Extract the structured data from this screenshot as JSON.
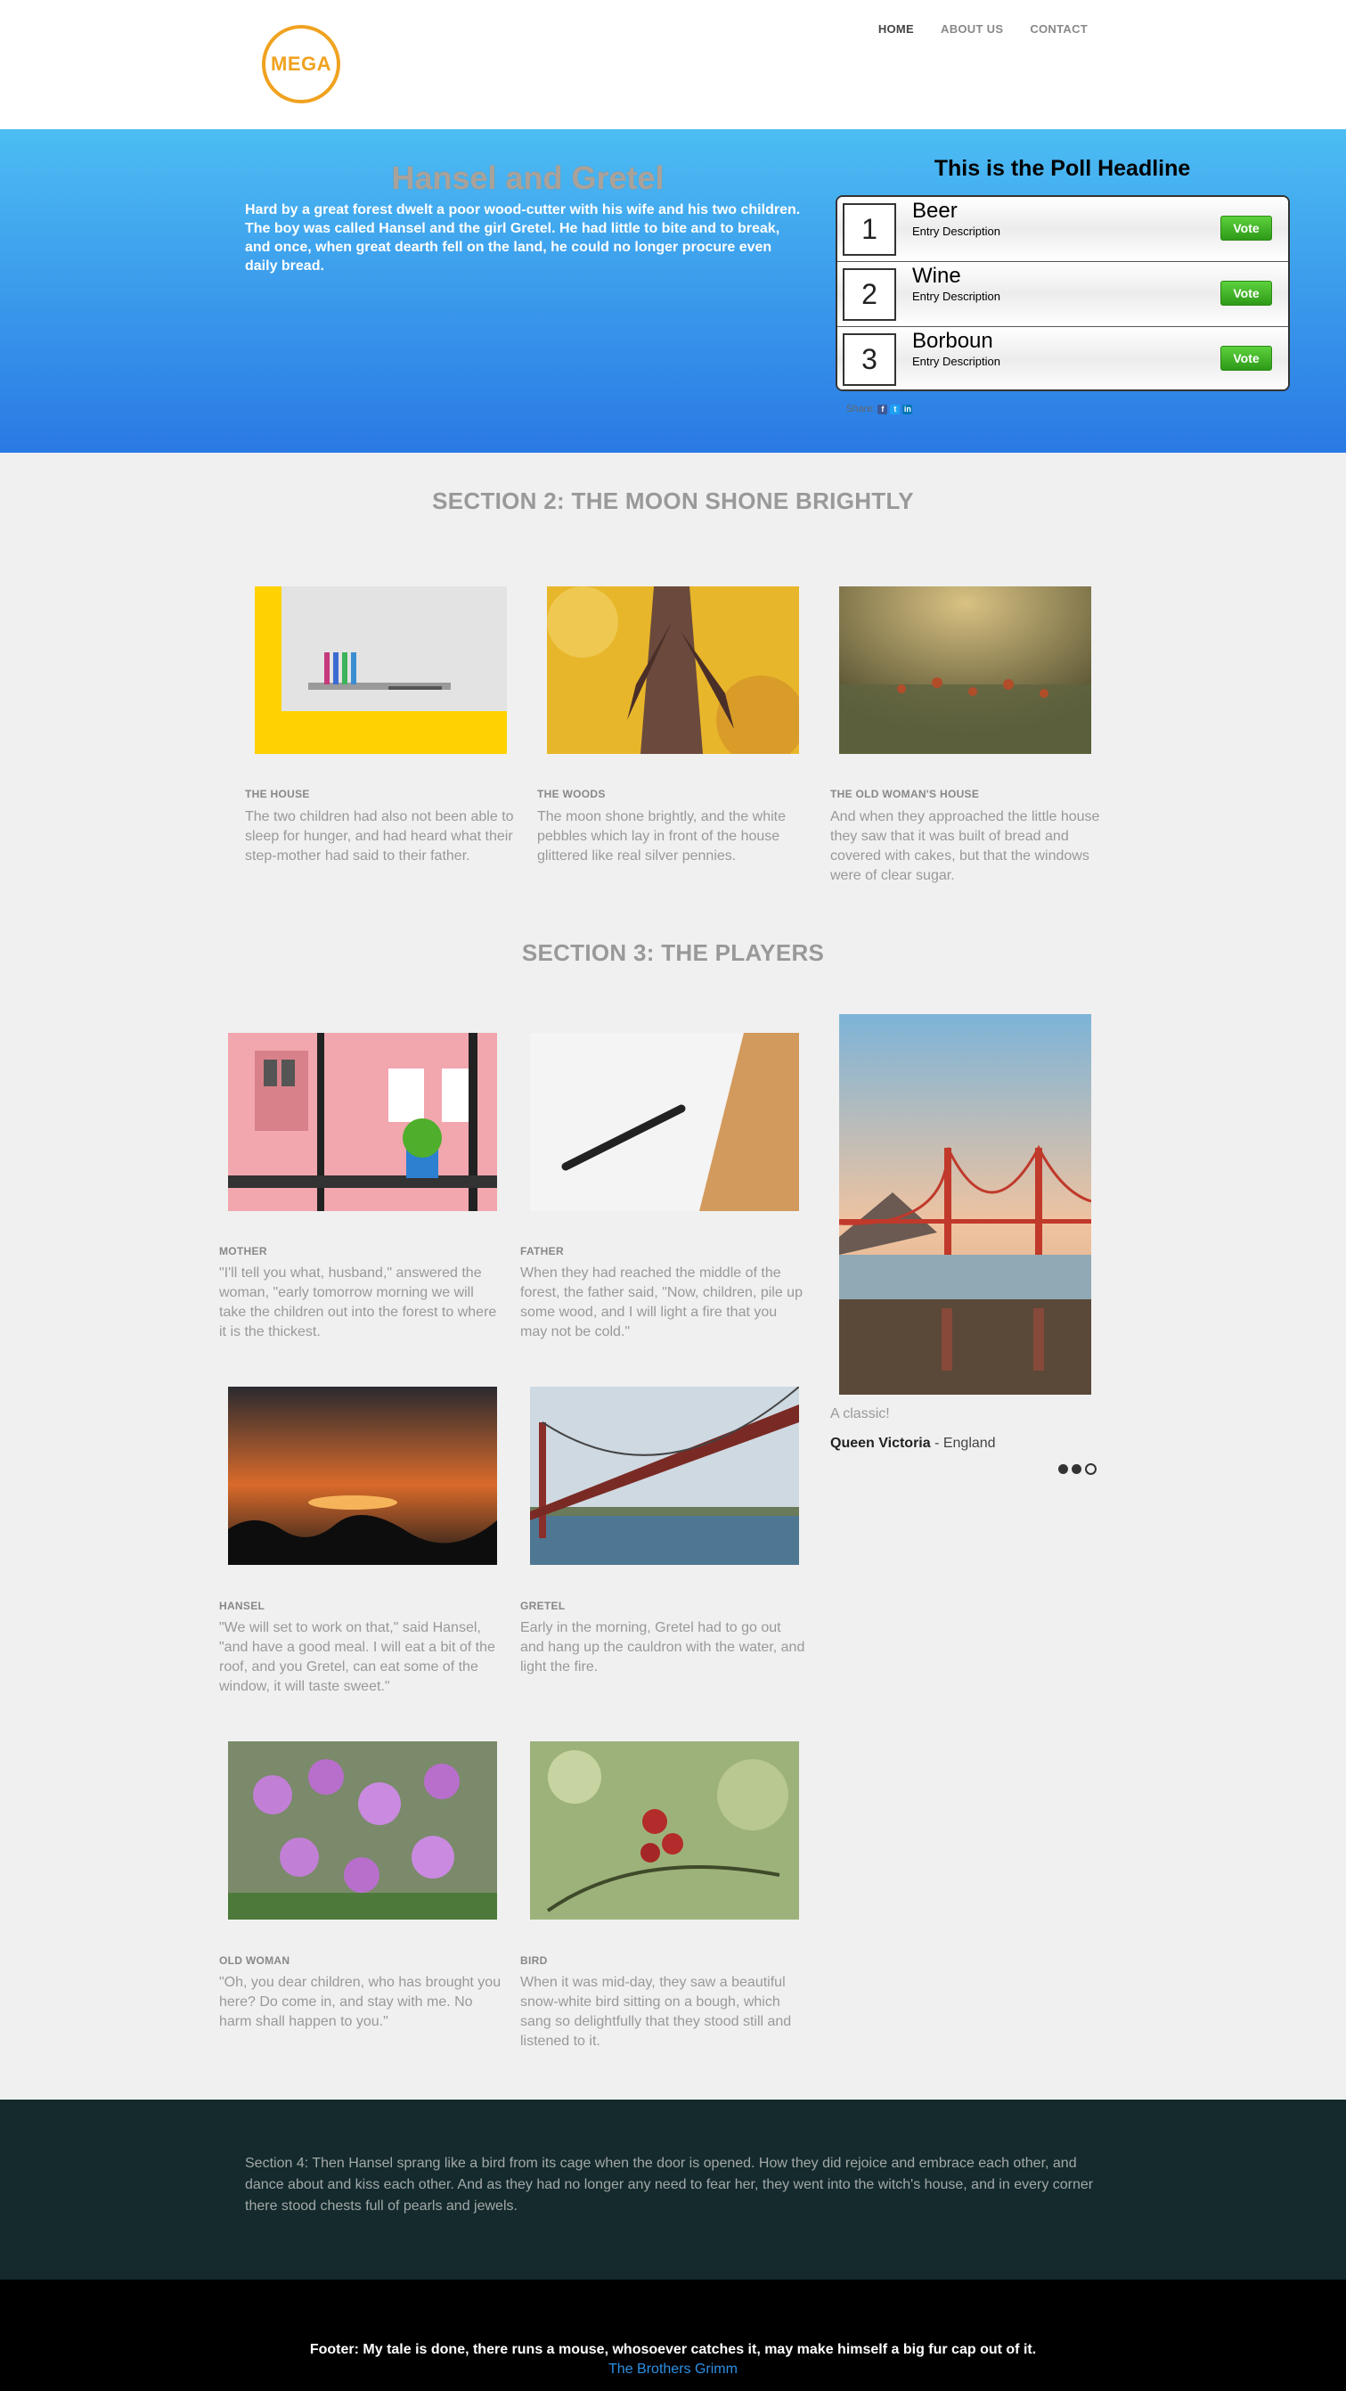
{
  "header": {
    "logo_text": "MEGA",
    "nav": [
      {
        "label": "HOME",
        "active": true
      },
      {
        "label": "ABOUT US",
        "active": false
      },
      {
        "label": "CONTACT",
        "active": false
      }
    ]
  },
  "hero": {
    "title": "Hansel and Gretel",
    "text": "Hard by a great forest dwelt a poor wood-cutter with his wife and his two children. The boy was called Hansel and the girl Gretel. He had little to bite and to break, and once, when great dearth fell on the land, he could no longer procure even daily bread."
  },
  "poll": {
    "headline": "This is the Poll Headline",
    "items": [
      {
        "number": "1",
        "name": "Beer",
        "description": "Entry Description",
        "vote_label": "Vote"
      },
      {
        "number": "2",
        "name": "Wine",
        "description": "Entry Description",
        "vote_label": "Vote"
      },
      {
        "number": "3",
        "name": "Borboun",
        "description": "Entry Description",
        "vote_label": "Vote"
      }
    ],
    "share_label": "Share:",
    "share_icons": [
      "facebook-icon",
      "twitter-icon",
      "linkedin-icon"
    ]
  },
  "section2": {
    "title": "SECTION 2: THE MOON SHONE BRIGHTLY",
    "cards": [
      {
        "label": "THE HOUSE",
        "text": "The two children had also not been able to sleep for hunger, and had heard what their step-mother had said to their father."
      },
      {
        "label": "THE WOODS",
        "text": "The moon shone brightly, and the white pebbles which lay in front of the house glittered like real silver pennies."
      },
      {
        "label": "THE OLD WOMAN'S HOUSE",
        "text": "And when they approached the little house they saw that it was built of bread and covered with cakes, but that the windows were of clear sugar."
      }
    ]
  },
  "section3": {
    "title": "SECTION 3: THE PLAYERS",
    "players": [
      {
        "label": "MOTHER",
        "text": "\"I'll tell you what, husband,\" answered the woman, \"early tomorrow morning we will take the children out into the forest to where it is the thickest."
      },
      {
        "label": "FATHER",
        "text": "When they had reached the middle of the forest, the father said, \"Now, children, pile up some wood, and I will light a fire that you may not be cold.\""
      },
      {
        "label": "HANSEL",
        "text": "\"We will set to work on that,\" said Hansel, \"and have a good meal. I will eat a bit of the roof, and you Gretel, can eat some of the window, it will taste sweet.\""
      },
      {
        "label": "GRETEL",
        "text": "Early in the morning, Gretel had to go out and hang up the cauldron with the water, and light the fire."
      },
      {
        "label": "OLD WOMAN",
        "text": "\"Oh, you dear children, who has brought you here? Do come in, and stay with me. No harm shall happen to you.\""
      },
      {
        "label": "BIRD",
        "text": "When it was mid-day, they saw a beautiful snow-white bird sitting on a bough, which sang so delightfully that they stood still and listened to it."
      }
    ],
    "testimonial": {
      "quote": "A classic!",
      "author": "Queen Victoria",
      "location": " - England"
    }
  },
  "section4": {
    "text": "Section 4: Then Hansel sprang like a bird from its cage when the door is opened. How they did rejoice and embrace each other, and dance about and kiss each other. And as they had no longer any need to fear her, they went into the witch's house, and in every corner there stood chests full of pearls and jewels."
  },
  "footer": {
    "text": "Footer: My tale is done, there runs a mouse, whosoever catches it, may make himself a big fur cap out of it.",
    "link": "The Brothers Grimm"
  },
  "colors": {
    "accent": "#f0a21f",
    "hero_top": "#4cbdf3",
    "hero_bottom": "#2a79e4",
    "vote_green": "#3fb023",
    "section4_bg": "#142a2c",
    "footer_link": "#2d8fe3"
  }
}
